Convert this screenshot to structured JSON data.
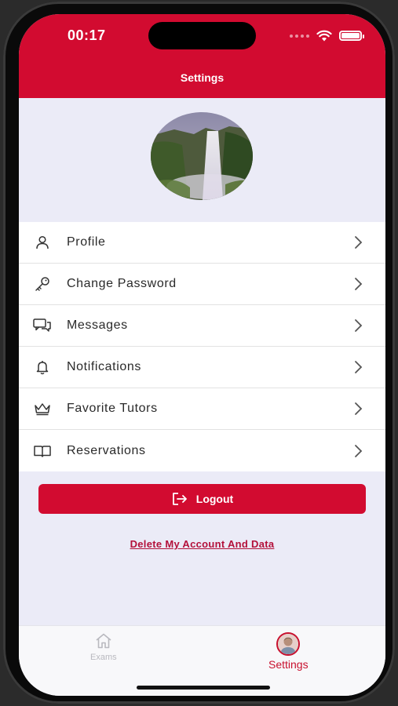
{
  "status_bar": {
    "time": "00:17"
  },
  "header": {
    "title": "Settings"
  },
  "menu": {
    "items": [
      {
        "label": "Profile",
        "icon": "person-icon"
      },
      {
        "label": "Change Password",
        "icon": "key-icon"
      },
      {
        "label": "Messages",
        "icon": "chat-bubbles-icon"
      },
      {
        "label": "Notifications",
        "icon": "bell-icon"
      },
      {
        "label": "Favorite Tutors",
        "icon": "crown-icon"
      },
      {
        "label": "Reservations",
        "icon": "open-book-icon"
      }
    ]
  },
  "logout": {
    "label": "Logout",
    "icon": "logout-icon"
  },
  "delete_account": {
    "label": "Delete My Account And Data"
  },
  "tabbar": {
    "tabs": [
      {
        "label": "Exams",
        "icon": "home-icon",
        "active": false
      },
      {
        "label": "Settings",
        "icon": "avatar-icon",
        "active": true
      }
    ]
  },
  "colors": {
    "brand": "#d20b30",
    "background": "#ebebf7",
    "tab_inactive": "#b9b9bf"
  }
}
